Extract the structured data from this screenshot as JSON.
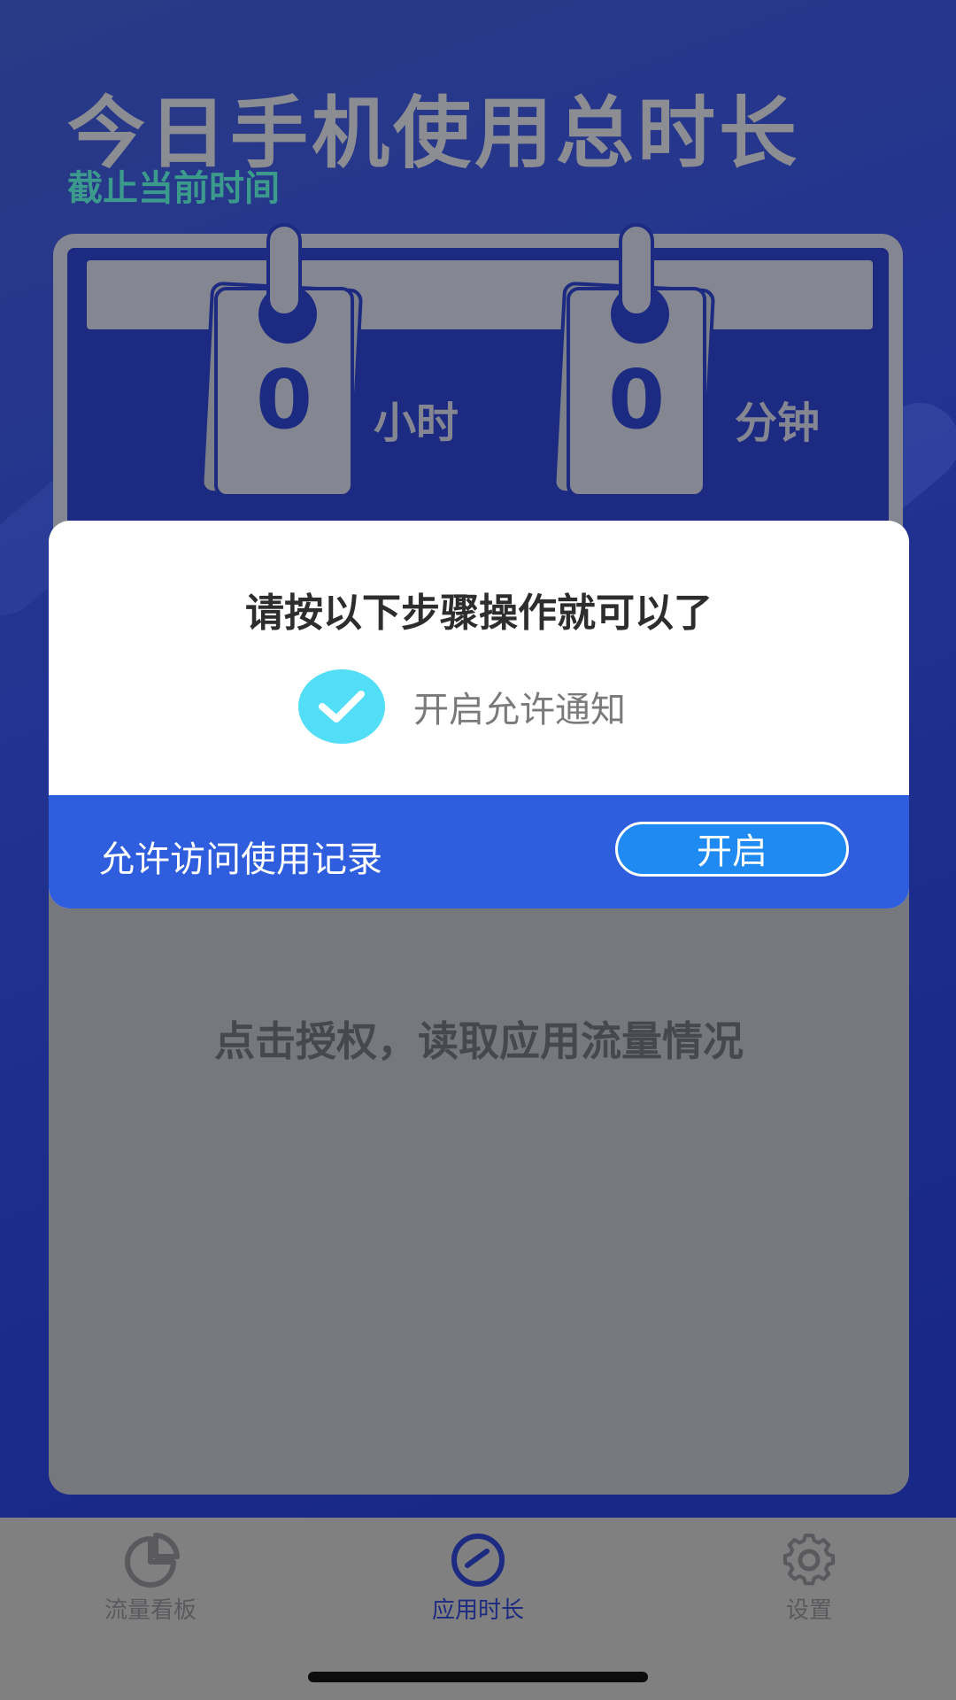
{
  "header": {
    "title": "今日手机使用总时长",
    "subtitle": "截止当前时间"
  },
  "usage": {
    "hours_value": "0",
    "hours_unit": "小时",
    "minutes_value": "0",
    "minutes_unit": "分钟"
  },
  "panel": {
    "prompt": "点击授权，读取应用流量情况"
  },
  "dialog": {
    "title": "请按以下步骤操作就可以了",
    "step_done_label": "开启允许通知",
    "step_pending_label": "允许访问使用记录",
    "open_button_label": "开启"
  },
  "tabs": [
    {
      "label": "流量看板",
      "icon": "pie-chart-icon",
      "active": false
    },
    {
      "label": "应用时长",
      "icon": "clock-icon",
      "active": true
    },
    {
      "label": "设置",
      "icon": "gear-icon",
      "active": false
    }
  ],
  "colors": {
    "background": "#223391",
    "accent_blue": "#2e5edd",
    "button_blue": "#1f8bf2",
    "check_cyan": "#52def6",
    "subtitle_teal": "#3c9a8c"
  }
}
